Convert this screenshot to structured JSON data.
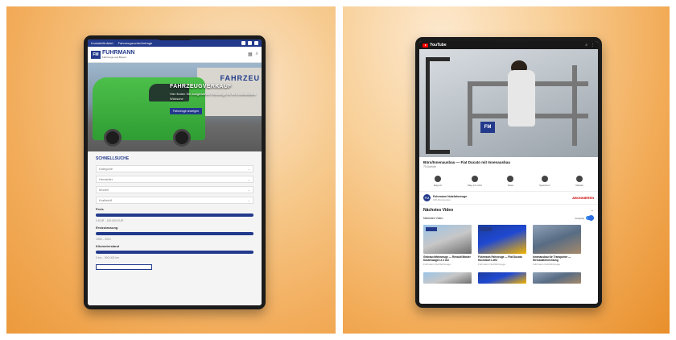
{
  "left_device": {
    "topbar": {
      "link_1": "Kontakt/Anfahrt",
      "link_2": "Fahrzeugsuche/Anfrage"
    },
    "brand": {
      "logo_mark": "FM",
      "logo_name": "FUHRMANN",
      "logo_tagline": "Fahrzeuge aus Bayern"
    },
    "hero": {
      "building_sign": "FAHRZEU",
      "title": "FAHRZEUGVERKAUF",
      "subtitle": "Hier finden Sie ausgewählte Fahrzeuge für Ihre individuellen Wünsche",
      "button": "Fahrzeuge anzeigen"
    },
    "search": {
      "title": "SCHNELLSUCHE",
      "selects": [
        "Kategorie",
        "Hersteller",
        "Modell",
        "Kraftstoff"
      ],
      "ranges": [
        {
          "label": "Preis",
          "value": "0 EUR - 100.000 EUR"
        },
        {
          "label": "Erstzulassung",
          "value": "1990 - 2024"
        },
        {
          "label": "Kilometerstand",
          "value": "0 km - 500.000 km"
        }
      ]
    }
  },
  "right_device": {
    "app": {
      "name": "YouTube"
    },
    "video": {
      "overlay_logo": "FM",
      "title": "Büro/Innenausbau — Fiat Ducato mit Innenausbau",
      "views": "75 Aufrufe"
    },
    "actions": [
      "Mag ich",
      "Mag ich nicht",
      "Teilen",
      "Speichern",
      "Melden"
    ],
    "channel": {
      "avatar": "FM",
      "name": "Fuhrmann Nutzfahrzeuge",
      "subs": "105 Abonnenten",
      "subscribe": "ABONNIEREN"
    },
    "up_next": {
      "title": "Nächstes Video",
      "autoplay_label": "Nächstes Video",
      "autoplay_toggle": "Autoplay"
    },
    "suggestions": [
      {
        "title": "Gebrauchtfahrzeuge — Renault Master Kastenwagen 2.3 dCi",
        "meta": "Fuhrmann Nutzfahrzeuge"
      },
      {
        "title": "Fuhrmann Fahrzeuge — Fiat Ducato Hochdach L4H2",
        "meta": "Fuhrmann Nutzfahrzeuge"
      },
      {
        "title": "Innenausbau für Transporter — Werkstatteinrichtung",
        "meta": "Fuhrmann Nutzfahrzeuge"
      }
    ]
  }
}
